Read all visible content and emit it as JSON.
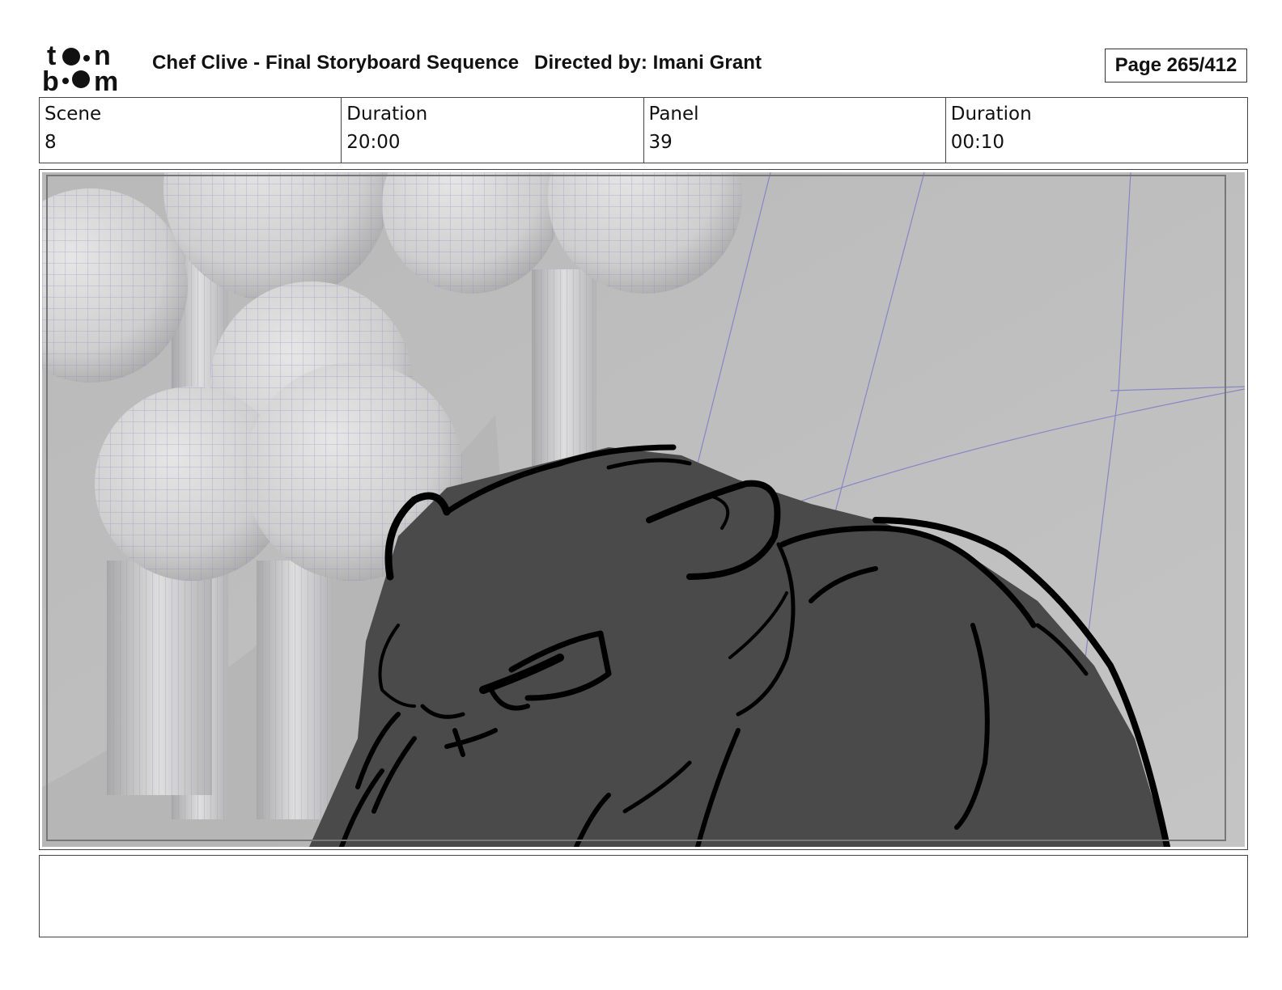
{
  "header": {
    "logo_text": "toon boom",
    "title": "Chef Clive - Final Storyboard Sequence",
    "directed_by": "Directed by: Imani Grant",
    "page": "Page 265/412"
  },
  "info": [
    {
      "label": "Scene",
      "value": "8"
    },
    {
      "label": "Duration",
      "value": "20:00"
    },
    {
      "label": "Panel",
      "value": "39"
    },
    {
      "label": "Duration",
      "value": "00:10"
    }
  ],
  "panel": {
    "description": ""
  },
  "notes": {
    "text": ""
  },
  "colors": {
    "background_wall": "#bdbdbd",
    "sphere": "#d6d6d6",
    "wireframe": "#8585c4",
    "character_fill": "#4a4a4a",
    "ink": "#000000"
  }
}
